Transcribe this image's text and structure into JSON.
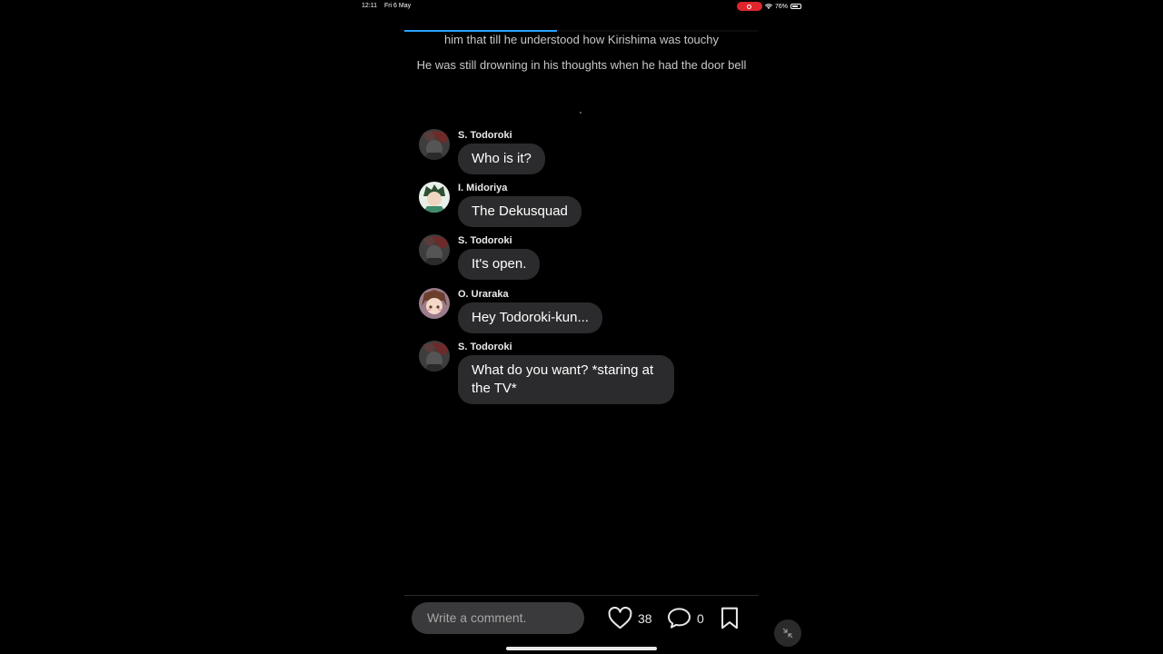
{
  "status_bar": {
    "time": "12:11",
    "date": "Fri 6 May",
    "battery": "76%",
    "battery_level": 0.76
  },
  "reader": {
    "progress": 0.43,
    "narration": [
      "him that till he understood how Kirishima was touchy",
      "He was still drowning in his thoughts when he had the door bell"
    ]
  },
  "messages": [
    {
      "sender": "S. Todoroki",
      "text": "Who is it?",
      "avatar": "todoroki-avatar"
    },
    {
      "sender": "I. Midoriya",
      "text": "The Dekusquad",
      "avatar": "midoriya-avatar"
    },
    {
      "sender": "S. Todoroki",
      "text": "It's open.",
      "avatar": "todoroki-avatar"
    },
    {
      "sender": "O. Uraraka",
      "text": "Hey Todoroki-kun...",
      "avatar": "uraraka-avatar"
    },
    {
      "sender": "S. Todoroki",
      "text": "What do you want? *staring at the TV*",
      "avatar": "todoroki-avatar"
    }
  ],
  "bottom_bar": {
    "comment_placeholder": "Write a comment.",
    "likes": "38",
    "comments": "0",
    "icons": [
      "heart-icon",
      "comment-icon",
      "bookmark-icon",
      "minimize-icon"
    ]
  },
  "colors": {
    "background": "#000000",
    "bubble": "#2b2b2d",
    "accent": "#2aa4ff",
    "record": "#e0262d"
  }
}
